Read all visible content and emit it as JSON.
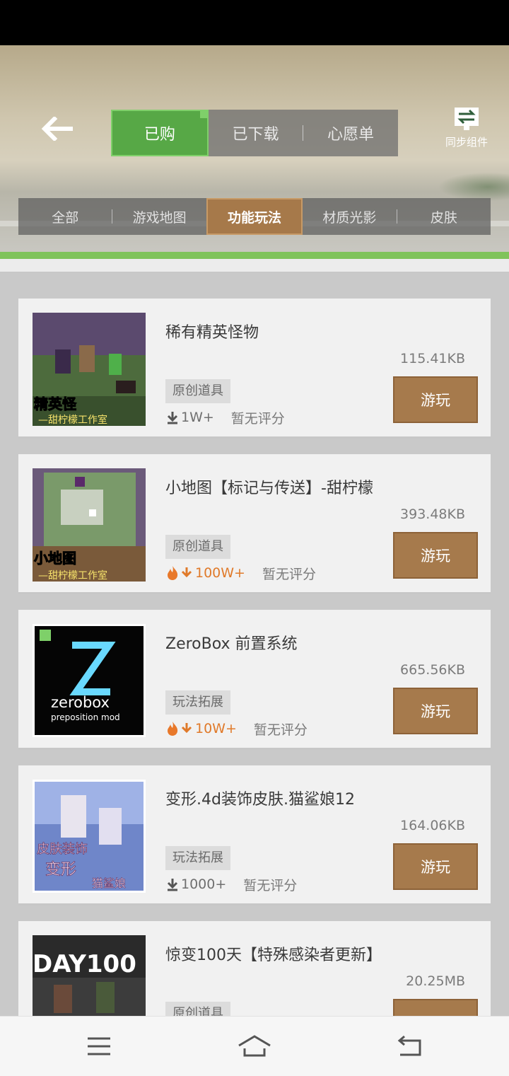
{
  "header": {
    "tabs": [
      {
        "label": "已购",
        "active": true
      },
      {
        "label": "已下载",
        "active": false
      },
      {
        "label": "心愿单",
        "active": false
      }
    ],
    "sync_label": "同步组件"
  },
  "categories": [
    {
      "label": "全部",
      "active": false
    },
    {
      "label": "游戏地图",
      "active": false
    },
    {
      "label": "功能玩法",
      "active": true
    },
    {
      "label": "材质光影",
      "active": false
    },
    {
      "label": "皮肤",
      "active": false
    }
  ],
  "items": [
    {
      "title": "稀有精英怪物",
      "size": "115.41KB",
      "tag": "原创道具",
      "downloads": "1W+",
      "hot": false,
      "rating": "暂无评分",
      "play_label": "游玩",
      "thumb_text": [
        "精英怪",
        "—甜柠檬工作室"
      ]
    },
    {
      "title": "小地图【标记与传送】-甜柠檬",
      "size": "393.48KB",
      "tag": "原创道具",
      "downloads": "100W+",
      "hot": true,
      "rating": "暂无评分",
      "play_label": "游玩",
      "thumb_text": [
        "小地图",
        "—甜柠檬工作室"
      ]
    },
    {
      "title": "ZeroBox 前置系统",
      "size": "665.56KB",
      "tag": "玩法拓展",
      "downloads": "10W+",
      "hot": true,
      "rating": "暂无评分",
      "play_label": "游玩",
      "thumb_text": [
        "zerobox",
        "preposition mod"
      ]
    },
    {
      "title": "变形.4d装饰皮肤.猫鲨娘12",
      "size": "164.06KB",
      "tag": "玩法拓展",
      "downloads": "1000+",
      "hot": false,
      "rating": "暂无评分",
      "play_label": "游玩",
      "thumb_text": [
        "皮肤装饰",
        "变形",
        "猫鲨娘"
      ]
    },
    {
      "title": "惊变100天【特殊感染者更新】",
      "size": "20.25MB",
      "tag": "原创道具",
      "downloads": "",
      "hot": false,
      "rating": "",
      "play_label": "",
      "thumb_text": [
        "DAY100"
      ]
    }
  ],
  "colors": {
    "tab_active": "#57a846",
    "category_active": "#a6794a",
    "play_button": "#a67a4c",
    "hot_orange": "#e07a2a"
  },
  "navbar": {
    "icons": [
      "menu-icon",
      "home-icon",
      "back-icon"
    ]
  }
}
